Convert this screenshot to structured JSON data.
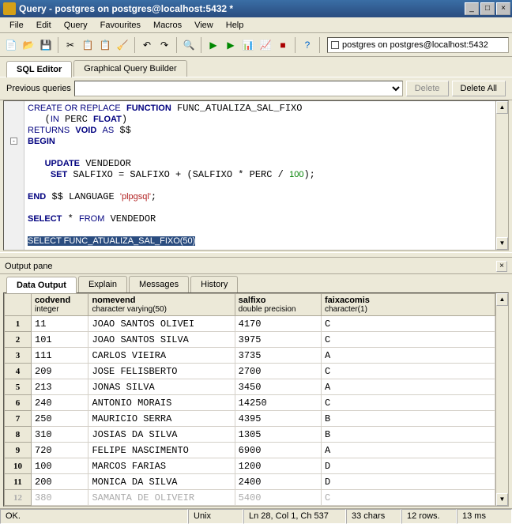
{
  "window": {
    "title": "Query - postgres on postgres@localhost:5432 *",
    "min": "_",
    "max": "□",
    "close": "×"
  },
  "menu": [
    "File",
    "Edit",
    "Query",
    "Favourites",
    "Macros",
    "View",
    "Help"
  ],
  "dbindicator": "postgres on postgres@localhost:5432",
  "editor_tabs": {
    "active": "SQL Editor",
    "other": "Graphical Query Builder"
  },
  "prevq": {
    "label": "Previous queries",
    "delete": "Delete",
    "delete_all": "Delete All"
  },
  "out_header": "Output pane",
  "out_close": "×",
  "output_tabs": [
    "Data Output",
    "Explain",
    "Messages",
    "History"
  ],
  "cols": [
    {
      "name": "codvend",
      "type": "integer"
    },
    {
      "name": "nomevend",
      "type": "character varying(50)"
    },
    {
      "name": "salfixo",
      "type": "double precision"
    },
    {
      "name": "faixacomis",
      "type": "character(1)"
    }
  ],
  "rows": [
    [
      "11",
      "JOAO SANTOS OLIVEI",
      "4170",
      "C"
    ],
    [
      "101",
      "JOAO SANTOS SILVA",
      "3975",
      "C"
    ],
    [
      "111",
      "CARLOS VIEIRA",
      "3735",
      "A"
    ],
    [
      "209",
      "JOSE FELISBERTO",
      "2700",
      "C"
    ],
    [
      "213",
      "JONAS SILVA",
      "3450",
      "A"
    ],
    [
      "240",
      "ANTONIO MORAIS",
      "14250",
      "C"
    ],
    [
      "250",
      "MAURICIO SERRA",
      "4395",
      "B"
    ],
    [
      "310",
      "JOSIAS DA SILVA",
      "1305",
      "B"
    ],
    [
      "720",
      "FELIPE NASCIMENTO",
      "6900",
      "A"
    ],
    [
      "100",
      "MARCOS FARIAS",
      "1200",
      "D"
    ],
    [
      "200",
      "MONICA DA SILVA",
      "2400",
      "D"
    ]
  ],
  "cutoff_row": [
    "380",
    "SAMANTA DE OLIVEIR",
    "5400",
    "C"
  ],
  "status": {
    "ok": "OK.",
    "encoding": "Unix",
    "pos": "Ln 28, Col 1, Ch 537",
    "chars": "33 chars",
    "rows": "12 rows.",
    "time": "13 ms"
  },
  "chart_data": {
    "type": "table",
    "title": "Data Output",
    "columns": [
      "codvend (integer)",
      "nomevend (character varying(50))",
      "salfixo (double precision)",
      "faixacomis (character(1))"
    ],
    "data": [
      [
        11,
        "JOAO SANTOS OLIVEI",
        4170,
        "C"
      ],
      [
        101,
        "JOAO SANTOS SILVA",
        3975,
        "C"
      ],
      [
        111,
        "CARLOS VIEIRA",
        3735,
        "A"
      ],
      [
        209,
        "JOSE FELISBERTO",
        2700,
        "C"
      ],
      [
        213,
        "JONAS SILVA",
        3450,
        "A"
      ],
      [
        240,
        "ANTONIO MORAIS",
        14250,
        "C"
      ],
      [
        250,
        "MAURICIO SERRA",
        4395,
        "B"
      ],
      [
        310,
        "JOSIAS DA SILVA",
        1305,
        "B"
      ],
      [
        720,
        "FELIPE NASCIMENTO",
        6900,
        "A"
      ],
      [
        100,
        "MARCOS FARIAS",
        1200,
        "D"
      ],
      [
        200,
        "MONICA DA SILVA",
        2400,
        "D"
      ],
      [
        380,
        "SAMANTA DE OLIVEIR",
        5400,
        "C"
      ]
    ]
  }
}
